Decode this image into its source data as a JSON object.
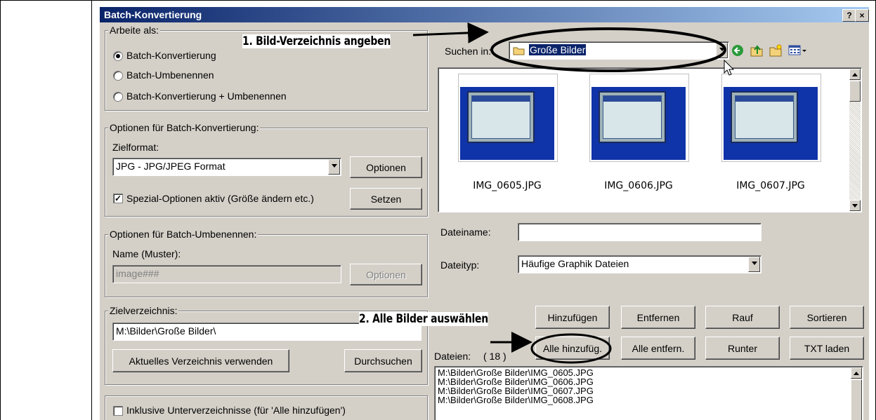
{
  "window": {
    "title": "Batch-Konvertierung",
    "help_btn": "?",
    "close_btn": "×"
  },
  "annotations": {
    "step1": "1. Bild-Verzeichnis angeben",
    "step2": "2. Alle Bilder auswählen"
  },
  "work_as": {
    "legend": "Arbeite als:",
    "options": [
      "Batch-Konvertierung",
      "Batch-Umbenennen",
      "Batch-Konvertierung + Umbenennen"
    ],
    "selected": 0
  },
  "conversion": {
    "legend": "Optionen für Batch-Konvertierung:",
    "format_label": "Zielformat:",
    "format_value": "JPG - JPG/JPEG Format",
    "options_btn": "Optionen",
    "special_label": "Spezial-Optionen aktiv (Größe ändern etc.)",
    "special_checked": true,
    "set_btn": "Setzen"
  },
  "rename": {
    "legend": "Optionen für Batch-Umbenennen:",
    "name_label": "Name (Muster):",
    "name_value": "image###",
    "options_btn": "Optionen"
  },
  "target": {
    "legend": "Zielverzeichnis:",
    "path": "M:\\Bilder\\Große Bilder\\",
    "current_btn": "Aktuelles Verzeichnis verwenden",
    "browse_btn": "Durchsuchen"
  },
  "subdirs": {
    "label": "Inklusive Unterverzeichnisse (für 'Alle hinzufügen')",
    "checked": false
  },
  "browser": {
    "look_in_label": "Suchen in:",
    "look_in_value": "Große Bilder",
    "thumbnails": [
      "IMG_0605.JPG",
      "IMG_0606.JPG",
      "IMG_0607.JPG"
    ],
    "filename_label": "Dateiname:",
    "filename_value": "",
    "filetype_label": "Dateityp:",
    "filetype_value": "Häufige Graphik Dateien"
  },
  "actions": {
    "add": "Hinzufügen",
    "remove": "Entfernen",
    "up": "Rauf",
    "sort": "Sortieren",
    "add_all": "Alle hinzufüg.",
    "remove_all": "Alle entfern.",
    "down": "Runter",
    "load_txt": "TXT laden"
  },
  "files": {
    "label": "Dateien:",
    "count": "( 18 )",
    "items": [
      "M:\\Bilder\\Große Bilder\\IMG_0605.JPG",
      "M:\\Bilder\\Große Bilder\\IMG_0606.JPG",
      "M:\\Bilder\\Große Bilder\\IMG_0607.JPG",
      "M:\\Bilder\\Große Bilder\\IMG_0608.JPG"
    ]
  },
  "colors": {
    "title_start": "#0a246a",
    "title_end": "#a6caf0",
    "dialog_bg": "#d4d0c8",
    "selection": "#0a246a"
  }
}
